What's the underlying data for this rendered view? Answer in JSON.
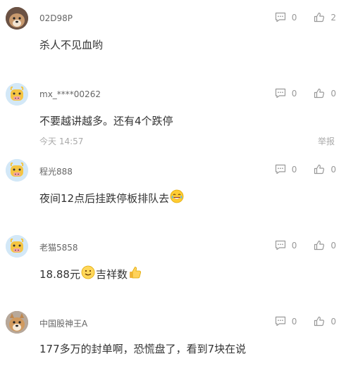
{
  "comments": [
    {
      "username": "02D98P",
      "text": "杀人不见血哟",
      "reply_count": "0",
      "like_count": "2",
      "avatar": "dog-photo-avatar"
    },
    {
      "username": "mx_****00262",
      "text": "不要越讲越多。还有4个跌停",
      "reply_count": "0",
      "like_count": "0",
      "time": "今天 14:57",
      "report_label": "举报",
      "avatar": "cow-avatar"
    },
    {
      "username": "程光888",
      "text": "夜间12点后挂跌停板排队去",
      "reply_count": "0",
      "like_count": "0",
      "avatar": "cow-avatar",
      "emoji": "crying-laughing-emoji"
    },
    {
      "username": "老猫5858",
      "text_before": "18.88元",
      "text_middle": "吉祥数",
      "reply_count": "0",
      "like_count": "0",
      "avatar": "cow-avatar",
      "emoji_1": "smile-emoji",
      "emoji_2": "thumbs-up-emoji"
    },
    {
      "username": "中国股神王A",
      "text": "177多万的封单啊，恐慌盘了，看到7块在说",
      "reply_count": "0",
      "like_count": "0",
      "avatar": "dog-photo-avatar"
    }
  ],
  "colors": {
    "text": "#333333",
    "username": "#666666",
    "meta": "#aaaaaa",
    "icon": "#999999",
    "avatar_bg": "#d3e8f7"
  }
}
